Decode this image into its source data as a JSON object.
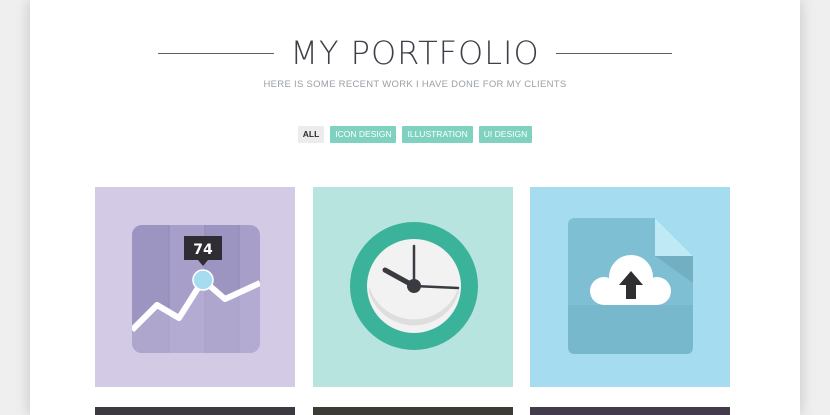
{
  "header": {
    "title": "MY PORTFOLIO",
    "subtitle": "HERE IS SOME RECENT WORK I HAVE DONE FOR MY CLIENTS"
  },
  "filters": {
    "all": "ALL",
    "icon_design": "ICON DESIGN",
    "illustration": "ILLUSTRATION",
    "ui_design": "UI DESIGN"
  },
  "portfolio": {
    "items": [
      {
        "icon": "line-chart-icon",
        "value_label": "74",
        "color": "#d3cbe5"
      },
      {
        "icon": "clock-icon",
        "color": "#b7e4de"
      },
      {
        "icon": "cloud-upload-file-icon",
        "color": "#a6dcef"
      }
    ]
  },
  "colors": {
    "accent": "#7fd2bf",
    "title": "#3d4048",
    "subtitle": "#9aa0a6"
  }
}
